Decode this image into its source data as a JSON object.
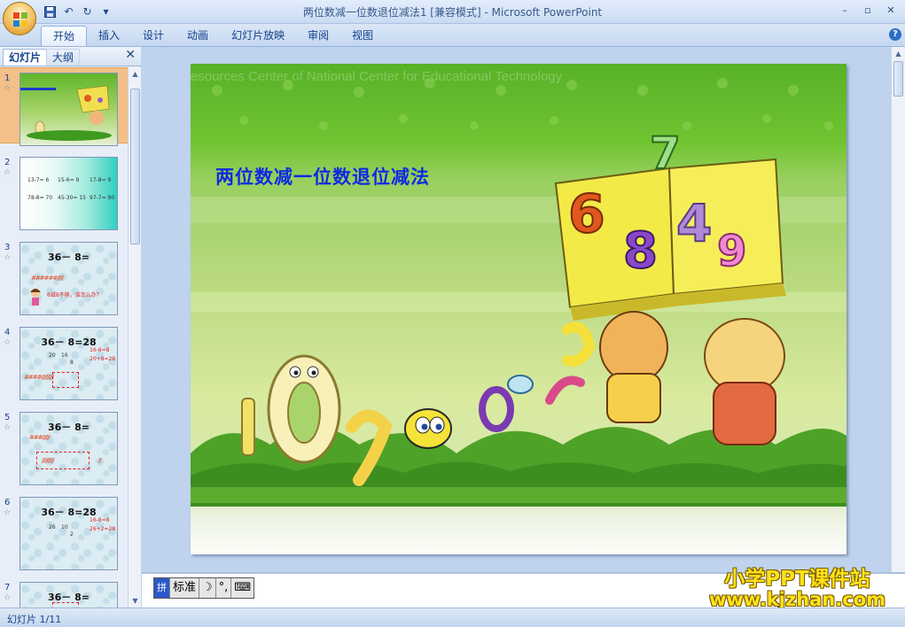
{
  "window": {
    "title": "两位数减一位数退位减法1 [兼容模式] - Microsoft PowerPoint",
    "controls": {
      "minimize": "–",
      "restore": "▫",
      "close": "✕"
    }
  },
  "quick_access": {
    "undo_glyph": "↶",
    "redo_glyph": "↻",
    "more_glyph": "▾"
  },
  "ribbon": {
    "tabs": [
      {
        "label": "开始",
        "active": true
      },
      {
        "label": "插入"
      },
      {
        "label": "设计"
      },
      {
        "label": "动画"
      },
      {
        "label": "幻灯片放映"
      },
      {
        "label": "审阅"
      },
      {
        "label": "视图"
      }
    ],
    "help_glyph": "?"
  },
  "left_panel": {
    "tab_slides": "幻灯片",
    "tab_outline": "大纲",
    "close_glyph": "✕",
    "star_glyph": "☆",
    "thumbs": [
      {
        "num": "1"
      },
      {
        "num": "2",
        "lines": [
          "13-7= 6",
          "15-6= 9",
          "17-8= 9",
          "78-8= 70",
          "45-30= 15",
          "97-7= 90"
        ]
      },
      {
        "num": "3",
        "eq": "36－ 8=",
        "note": "6减8不够，该怎么办？"
      },
      {
        "num": "4",
        "eq": "36－ 8=28",
        "steps": [
          "16-8=8",
          "20+8=28"
        ],
        "split": [
          "20",
          "16",
          "8"
        ]
      },
      {
        "num": "5",
        "eq": "36－ 8="
      },
      {
        "num": "6",
        "eq": "36－ 8=28",
        "steps": [
          "16-8=8",
          "26+2=28"
        ],
        "split": [
          "26",
          "10",
          "2"
        ]
      },
      {
        "num": "7",
        "eq": "36－ 8="
      }
    ]
  },
  "slide": {
    "title": "两位数减一位数退位减法",
    "watermark": "esources Center of National Center for Educational Technology",
    "book_digits": [
      "6",
      "8",
      "4",
      "9",
      "7"
    ],
    "colors": {
      "title": "#0e2be0",
      "bg_top": "#58b127",
      "bg_mid": "#b3d778"
    }
  },
  "notes": {
    "ime": {
      "logo": "拼",
      "mode": "标准",
      "moon": "☽",
      "punct": "°,",
      "keyboard": "⌨"
    },
    "brand_top": "小学PPT课件站",
    "brand_bottom": "www.kjzhan.com"
  },
  "status": {
    "text": "幻灯片 1/11"
  }
}
